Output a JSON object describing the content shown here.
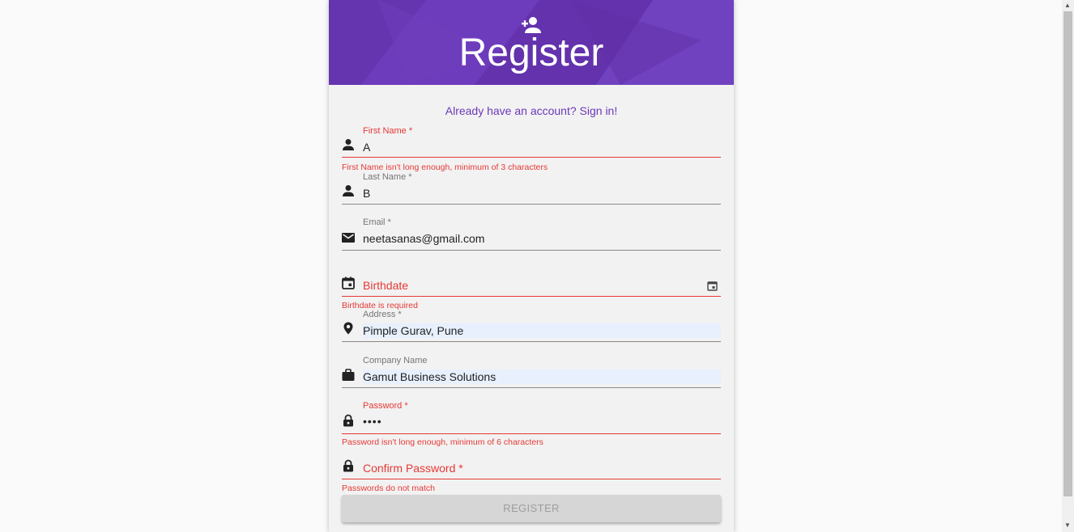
{
  "header": {
    "title": "Register"
  },
  "signin_link": "Already have an account? Sign in!",
  "fields": {
    "first_name": {
      "label": "First Name *",
      "value": "A",
      "error": "First Name isn't long enough, minimum of 3 characters"
    },
    "last_name": {
      "label": "Last Name *",
      "value": "B"
    },
    "email": {
      "label": "Email *",
      "value": "neetasanas@gmail.com"
    },
    "birthdate": {
      "placeholder": "Birthdate",
      "error": "Birthdate is required"
    },
    "address": {
      "label": "Address *",
      "value": "Pimple Gurav, Pune"
    },
    "company": {
      "label": "Company Name",
      "value": "Gamut Business Solutions"
    },
    "password": {
      "label": "Password *",
      "value": "••••",
      "error": "Password isn't long enough, minimum of 6 characters"
    },
    "confirm_password": {
      "placeholder": "Confirm Password *",
      "error": "Passwords do not match"
    }
  },
  "register_button": "REGISTER",
  "colors": {
    "accent": "#6a38b8",
    "error": "#e53935",
    "autofill": "#e8f0fe"
  }
}
